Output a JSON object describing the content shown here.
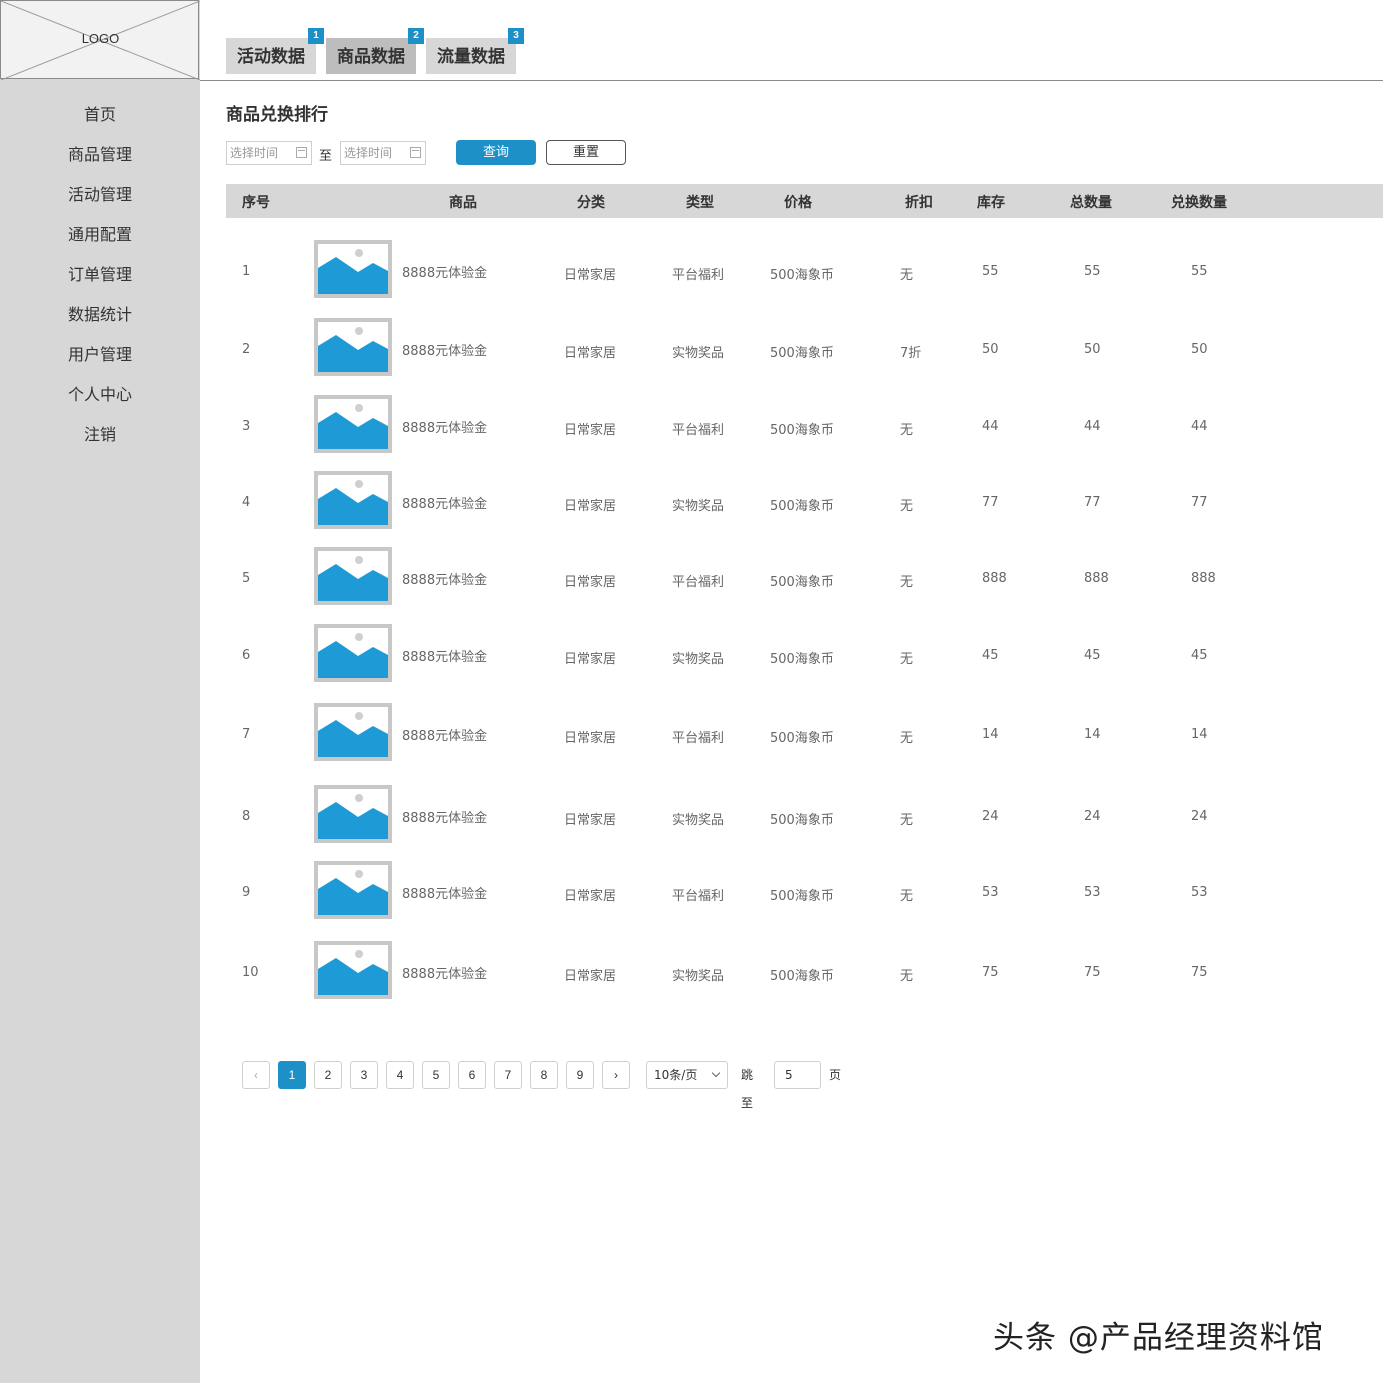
{
  "logo": {
    "text": "LOGO"
  },
  "sidebar": {
    "items": [
      {
        "label": "首页"
      },
      {
        "label": "商品管理"
      },
      {
        "label": "活动管理"
      },
      {
        "label": "通用配置"
      },
      {
        "label": "订单管理"
      },
      {
        "label": "数据统计"
      },
      {
        "label": "用户管理"
      },
      {
        "label": "个人中心"
      },
      {
        "label": "注销"
      }
    ]
  },
  "tabs": [
    {
      "label": "活动数据",
      "badge": "1",
      "active": false
    },
    {
      "label": "商品数据",
      "badge": "2",
      "active": true
    },
    {
      "label": "流量数据",
      "badge": "3",
      "active": false
    }
  ],
  "section": {
    "title": "商品兑换排行"
  },
  "filter": {
    "start_placeholder": "选择时间",
    "end_placeholder": "选择时间",
    "separator": "至",
    "query_label": "查询",
    "reset_label": "重置"
  },
  "table": {
    "headers": {
      "index": "序号",
      "product": "商品",
      "category": "分类",
      "type": "类型",
      "price": "价格",
      "discount": "折扣",
      "stock": "库存",
      "total": "总数量",
      "exchanged": "兑换数量"
    },
    "rows": [
      {
        "index": "1",
        "name": "8888元体验金",
        "category": "日常家居",
        "type": "平台福利",
        "price": "500海象币",
        "discount": "无",
        "stock": "55",
        "total": "55",
        "exchanged": "55"
      },
      {
        "index": "2",
        "name": "8888元体验金",
        "category": "日常家居",
        "type": "实物奖品",
        "price": "500海象币",
        "discount": "7折",
        "stock": "50",
        "total": "50",
        "exchanged": "50"
      },
      {
        "index": "3",
        "name": "8888元体验金",
        "category": "日常家居",
        "type": "平台福利",
        "price": "500海象币",
        "discount": "无",
        "stock": "44",
        "total": "44",
        "exchanged": "44"
      },
      {
        "index": "4",
        "name": "8888元体验金",
        "category": "日常家居",
        "type": "实物奖品",
        "price": "500海象币",
        "discount": "无",
        "stock": "77",
        "total": "77",
        "exchanged": "77"
      },
      {
        "index": "5",
        "name": "8888元体验金",
        "category": "日常家居",
        "type": "平台福利",
        "price": "500海象币",
        "discount": "无",
        "stock": "888",
        "total": "888",
        "exchanged": "888"
      },
      {
        "index": "6",
        "name": "8888元体验金",
        "category": "日常家居",
        "type": "实物奖品",
        "price": "500海象币",
        "discount": "无",
        "stock": "45",
        "total": "45",
        "exchanged": "45"
      },
      {
        "index": "7",
        "name": "8888元体验金",
        "category": "日常家居",
        "type": "平台福利",
        "price": "500海象币",
        "discount": "无",
        "stock": "14",
        "total": "14",
        "exchanged": "14"
      },
      {
        "index": "8",
        "name": "8888元体验金",
        "category": "日常家居",
        "type": "实物奖品",
        "price": "500海象币",
        "discount": "无",
        "stock": "24",
        "total": "24",
        "exchanged": "24"
      },
      {
        "index": "9",
        "name": "8888元体验金",
        "category": "日常家居",
        "type": "平台福利",
        "price": "500海象币",
        "discount": "无",
        "stock": "53",
        "total": "53",
        "exchanged": "53"
      },
      {
        "index": "10",
        "name": "8888元体验金",
        "category": "日常家居",
        "type": "实物奖品",
        "price": "500海象币",
        "discount": "无",
        "stock": "75",
        "total": "75",
        "exchanged": "75"
      }
    ]
  },
  "pagination": {
    "prev_icon": "‹",
    "next_icon": "›",
    "pages": [
      "1",
      "2",
      "3",
      "4",
      "5",
      "6",
      "7",
      "8",
      "9"
    ],
    "current": "1",
    "page_size": "10条/页",
    "jump_label": "跳至",
    "jump_value": "5",
    "page_label": "页"
  },
  "watermark": {
    "text": "头条 @产品经理资料馆"
  },
  "colors": {
    "accent": "#1e90c8",
    "sidebar_bg": "#d7d7d7",
    "header_bg": "#d7d7d7",
    "image_blue": "#1e9ad6"
  }
}
